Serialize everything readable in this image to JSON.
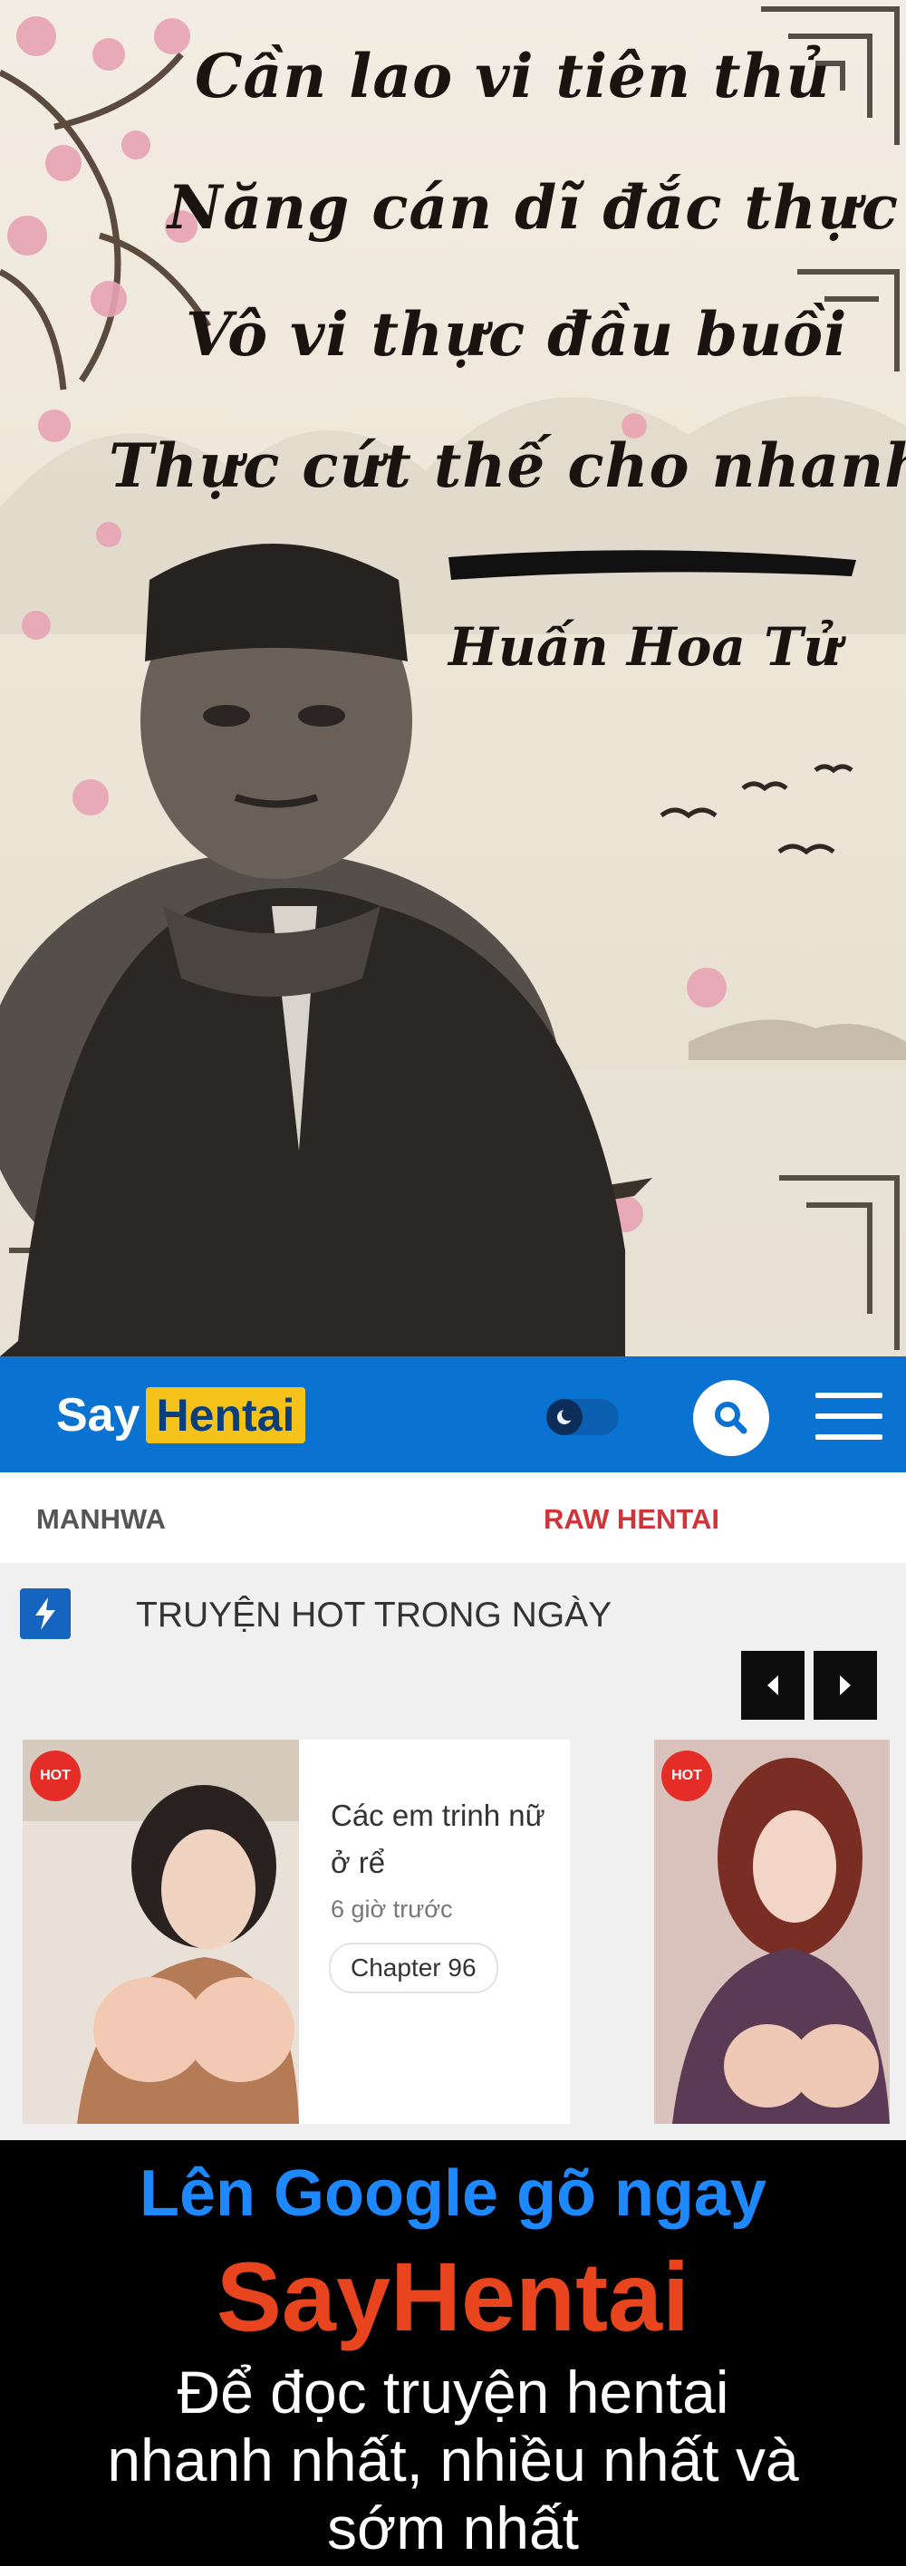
{
  "meme": {
    "poem": [
      "Cần lao vi tiên thủ",
      "Năng cán dĩ đắc thực",
      "Vô vi thực đầu buồi",
      "Thực cứt thế cho nhanh"
    ],
    "signature": "Huấn Hoa Tử"
  },
  "header": {
    "logo_say": "Say",
    "logo_hentai": "Hentai",
    "theme_toggle_icon": "moon-icon",
    "search_icon": "search-icon",
    "menu_icon": "hamburger-menu-icon",
    "brand_color": "#0a72d1",
    "logo_accent": "#f5c21a"
  },
  "tabs": [
    "MANHWA",
    "RAW HENTAI"
  ],
  "section": {
    "icon": "bolt-icon",
    "title": "TRUYỆN HOT TRONG NGÀY"
  },
  "carousel": {
    "prev_icon": "arrow-left-icon",
    "next_icon": "arrow-right-icon"
  },
  "cards": [
    {
      "badge": "HOT",
      "title": "Các em trinh nữ ở rể",
      "time": "6 giờ trước",
      "chapter": "Chapter 96"
    },
    {
      "badge": "HOT"
    }
  ],
  "ad": {
    "line1": "Lên Google gõ ngay",
    "line2": "SayHentai",
    "line3": "Để đọc truyện hentai",
    "line4": "nhanh nhất, nhiều nhất và",
    "line5": "sớm nhất"
  }
}
